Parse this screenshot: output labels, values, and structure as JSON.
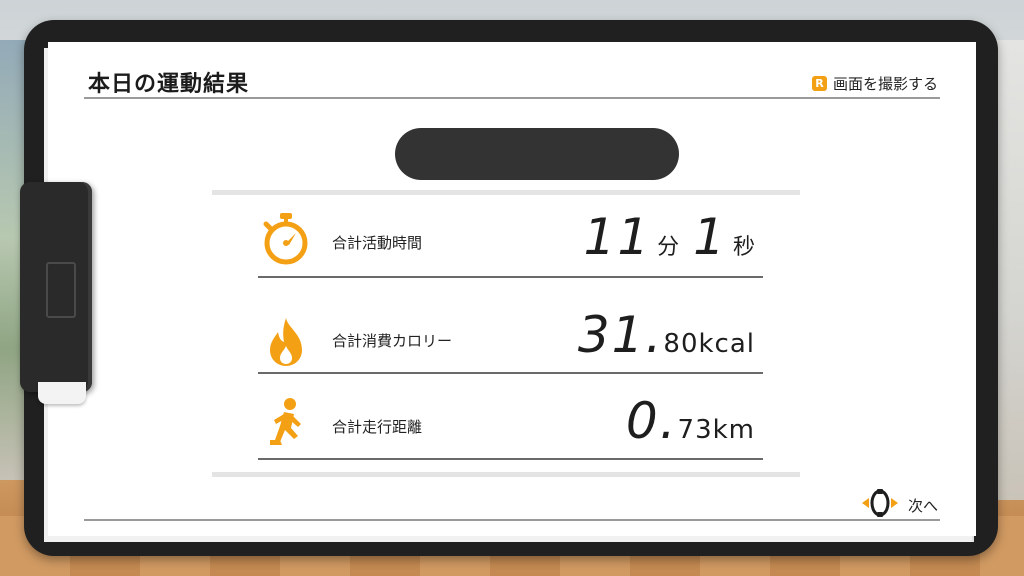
{
  "header": {
    "title": "本日の運動結果",
    "capture_badge": "R",
    "capture_label": "画面を撮影する"
  },
  "player": {
    "name_redacted": true
  },
  "results": [
    {
      "icon": "stopwatch-icon",
      "label": "合計活動時間",
      "value_minutes": "11",
      "unit_minutes": "分",
      "value_seconds": "1",
      "unit_seconds": "秒"
    },
    {
      "icon": "flame-icon",
      "label": "合計消費カロリー",
      "value_int": "31.",
      "value_dec": "80kcal"
    },
    {
      "icon": "running-person-icon",
      "label": "合計走行距離",
      "value_int": "0.",
      "value_dec": "73km"
    }
  ],
  "footer": {
    "next_icon": "ring-con-icon",
    "next_label": "次へ"
  },
  "colors": {
    "accent": "#f4a015",
    "board": "#202020",
    "paper": "#ffffff"
  }
}
